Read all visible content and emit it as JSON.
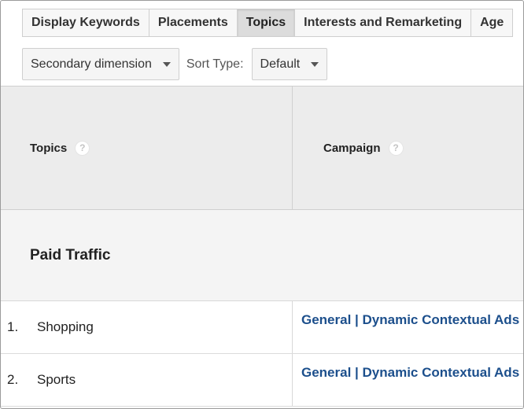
{
  "tabs": [
    {
      "label": "Display Keywords",
      "active": false
    },
    {
      "label": "Placements",
      "active": false
    },
    {
      "label": "Topics",
      "active": true
    },
    {
      "label": "Interests and Remarketing",
      "active": false
    },
    {
      "label": "Age",
      "active": false
    }
  ],
  "controls": {
    "secondary_dimension": "Secondary dimension",
    "sort_type_label": "Sort Type:",
    "sort_type_value": "Default"
  },
  "table": {
    "headers": {
      "topics": "Topics",
      "campaign": "Campaign",
      "help_glyph": "?"
    },
    "section_title": "Paid Traffic",
    "rows": [
      {
        "num": "1.",
        "topic": "Shopping",
        "campaign": "General | Dynamic Contextual Ads"
      },
      {
        "num": "2.",
        "topic": "Sports",
        "campaign": "General | Dynamic Contextual Ads"
      }
    ]
  },
  "colors": {
    "link": "#1c4f8c",
    "header_bg": "#ececec",
    "active_tab_bg": "#dcdcdc"
  }
}
